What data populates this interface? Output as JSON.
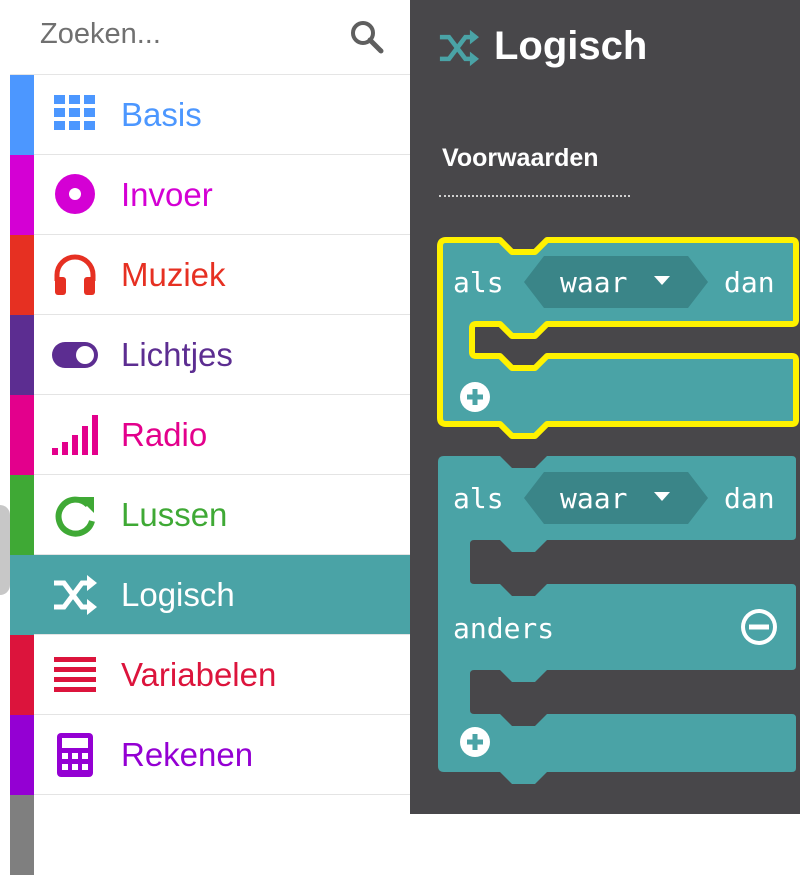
{
  "search": {
    "placeholder": "Zoeken..."
  },
  "categories": [
    {
      "label": "Basis",
      "color": "#4c97ff",
      "icon": "grid-icon"
    },
    {
      "label": "Invoer",
      "color": "#d400d4",
      "icon": "circle-dot-icon"
    },
    {
      "label": "Muziek",
      "color": "#e63022",
      "icon": "headphones-icon"
    },
    {
      "label": "Lichtjes",
      "color": "#5c2d91",
      "icon": "toggle-icon"
    },
    {
      "label": "Radio",
      "color": "#e3008c",
      "icon": "signal-bars-icon"
    },
    {
      "label": "Lussen",
      "color": "#00aa00",
      "icon": "refresh-icon"
    },
    {
      "label": "Logisch",
      "color": "#00a4a6",
      "icon": "shuffle-icon",
      "active": true
    },
    {
      "label": "Variabelen",
      "color": "#dc143c",
      "icon": "list-lines-icon"
    },
    {
      "label": "Rekenen",
      "color": "#9400d3",
      "icon": "calculator-icon"
    }
  ],
  "flyout": {
    "title": "Logisch",
    "section": "Voorwaarden",
    "block_color": "#4aa3a6",
    "highlight_color": "#fff200",
    "blocks": [
      {
        "if": "als",
        "value": "waar",
        "then": "dan"
      },
      {
        "if": "als",
        "value": "waar",
        "then": "dan",
        "else": "anders"
      }
    ]
  }
}
